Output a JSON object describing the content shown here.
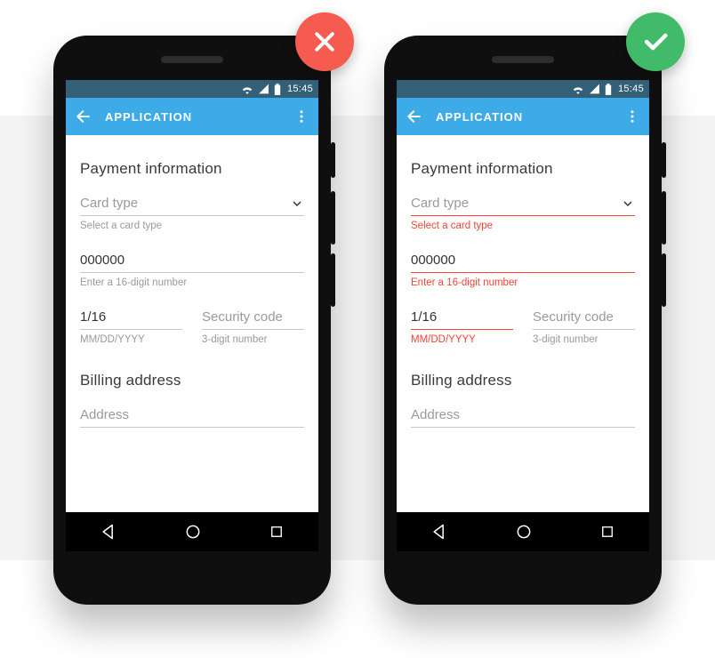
{
  "status": {
    "time": "15:45"
  },
  "appbar": {
    "title": "APPLICATION"
  },
  "sectionPayment": "Payment information",
  "sectionBilling": "Billing address",
  "cardType": {
    "placeholder": "Card type",
    "hint": "Select a card type"
  },
  "cardNumber": {
    "value": "000000",
    "hint": "Enter a 16-digit number"
  },
  "expiry": {
    "value": "1/16",
    "hint": "MM/DD/YYYY"
  },
  "csc": {
    "placeholder": "Security code",
    "hint": "3-digit number"
  },
  "address": {
    "placeholder": "Address"
  }
}
